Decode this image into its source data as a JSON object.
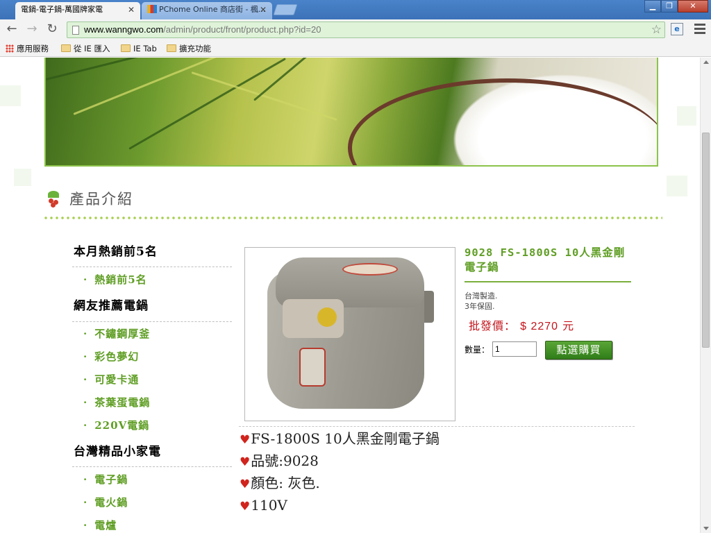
{
  "browser": {
    "tabs": [
      {
        "title": "電鍋-電子鍋-萬國牌家電",
        "active": true
      },
      {
        "title": "PChome Online 商店街 - 楓..."
      }
    ],
    "url_host": "www.wanngwo.com",
    "url_path": "/admin/product/front/product.php?id=20",
    "bookmarks": [
      "應用服務",
      "從 IE 匯入",
      "IE Tab",
      "擴充功能"
    ]
  },
  "section": {
    "title": "產品介紹"
  },
  "sidebar": {
    "groups": [
      {
        "heading": "本月熱銷前5名",
        "items": [
          "熱銷前5名"
        ]
      },
      {
        "heading": "網友推薦電鍋",
        "items": [
          "不鏽鋼厚釜",
          "彩色夢幻",
          "可愛卡通",
          "茶葉蛋電鍋",
          "220V電鍋"
        ]
      },
      {
        "heading": "台灣精品小家電",
        "items": [
          "電子鍋",
          "電火鍋",
          "電爐"
        ]
      }
    ]
  },
  "product": {
    "name": "9028 FS-1800S 10人黑金剛電子鍋",
    "notes": [
      "台灣製造.",
      "3年保固."
    ],
    "price_label": "批發價：",
    "price_value": "$ 2270",
    "price_unit": "元",
    "qty_label": "數量：",
    "qty_value": "1",
    "buy_label": "點選購買",
    "description": [
      "FS-1800S 10人黑金剛電子鍋",
      "品號:9028",
      "顏色: 灰色.",
      "110V"
    ]
  },
  "colors": {
    "accent_green": "#5f9e24",
    "price_red": "#c3141b",
    "banner_border": "#8cc34b"
  }
}
